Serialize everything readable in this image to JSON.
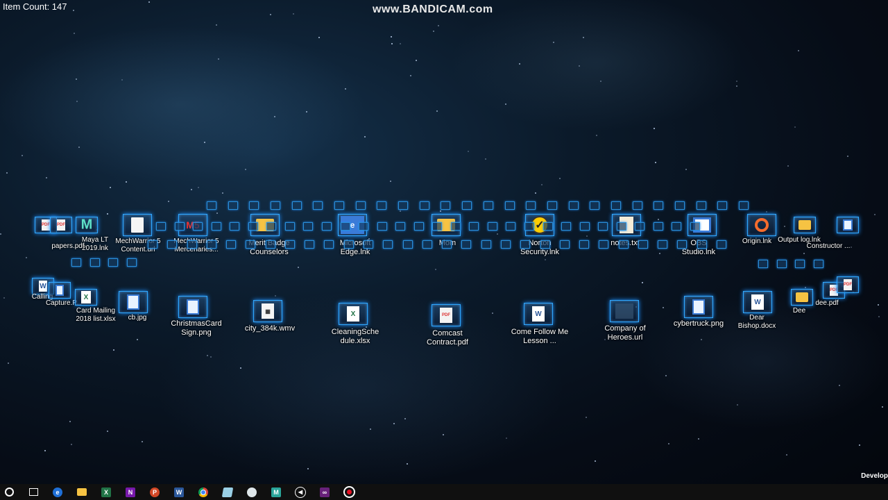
{
  "header": {
    "item_count": "Item Count: 147",
    "watermark": "www.BANDICAM.com",
    "developer_label": "Develop"
  },
  "desktop_icons": {
    "maya_lt": "Maya LT 2019.lnk",
    "mechwarrior_content": "MechWarrior 5 Content.url",
    "mechwarrior_mercenaries": "MechWarrior 5 Mercenaries...",
    "merit_badge": "Merit Badge Counselors",
    "microsoft_edge": "Microsoft Edge.lnk",
    "mom": "Mom",
    "norton": "Norton Security.lnk",
    "notes": "notes.txt",
    "obs": "OBS Studio.lnk",
    "origin": "Origin.lnk",
    "output_log": "Output log.lnk",
    "constructor": "Constructor ...",
    "papers": "papers.pdf",
    "capture": "Capture.P...",
    "calling": "Calling",
    "card_mailing": "Card Mailing 2018 list.xlsx",
    "cb": "cb.jpg",
    "christmas_card": "ChristmasCard Sign.png",
    "city": "city_384k.wmv",
    "cleaning": "CleaningSche dule.xlsx",
    "comcast": "Comcast Contract.pdf",
    "come_follow": "Come Follow Me Lesson ...",
    "company_heroes": "Company of Heroes.url",
    "cybertruck": "cybertruck.png",
    "dear_bishop": "Dear Bishop.docx",
    "dee": "Dee",
    "dee_pdf": "dee.pdf"
  },
  "taskbar": {
    "items": [
      "start-icon",
      "task-view-icon",
      "edge-icon",
      "file-explorer-icon",
      "excel-icon",
      "onenote-icon",
      "powerpoint-icon",
      "word-icon",
      "chrome-icon",
      "notepad-icon",
      "paint-icon",
      "maya-icon",
      "unreal-icon",
      "visual-studio-icon",
      "bandicam-record-icon"
    ],
    "colors": {
      "excel": "#217346",
      "onenote": "#7719aa",
      "powerpoint": "#d24726",
      "word": "#2b579a",
      "visual_studio": "#68217a",
      "record": "#e81123"
    }
  }
}
